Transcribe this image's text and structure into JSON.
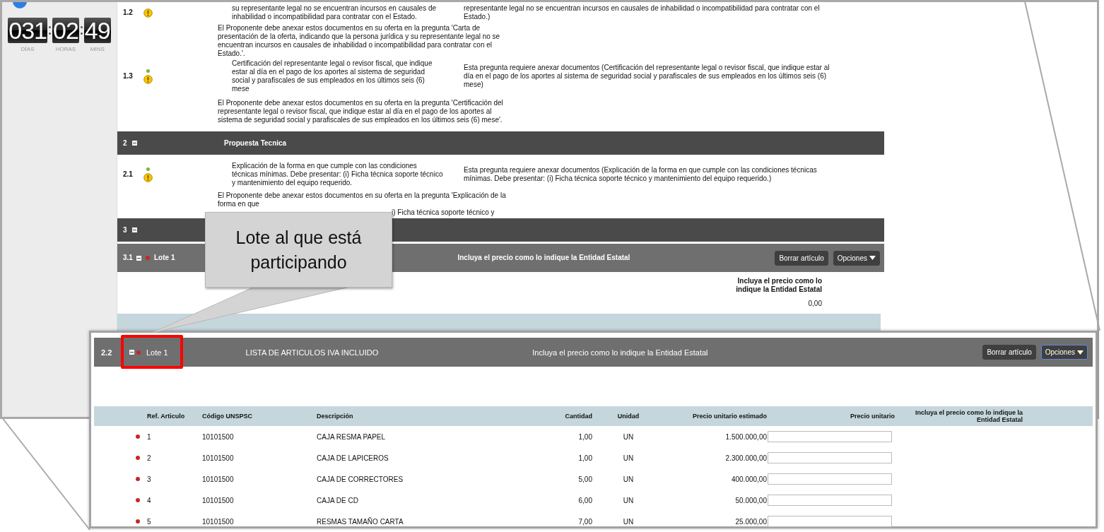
{
  "countdown": [
    {
      "value": "031",
      "label": "DÍAS"
    },
    {
      "value": "02",
      "label": "HORAS"
    },
    {
      "value": "49",
      "label": "MINS"
    }
  ],
  "items": [
    {
      "kind": "question",
      "number": "1.2",
      "warning": true,
      "text": "su representante legal no se encuentran incursos en causales de inhabilidad o incompatibilidad para contratar con el Estado.",
      "answer": "representante legal no se encuentran incursos en causales de inhabilidad o incompatibilidad para contratar con el Estado.)"
    },
    {
      "kind": "note",
      "text": "El Proponente debe anexar estos documentos en su oferta en la pregunta 'Carta de presentación de la oferta, indicando que la persona jurídica y su representante legal no se encuentran incursos en causales de inhabilidad o incompatibilidad para contratar con el Estado.'."
    },
    {
      "kind": "question",
      "number": "1.3",
      "color": "#7cb342",
      "warning": true,
      "text": "Certificación del representante legal o revisor fiscal, que indique estar al día en el pago de los aportes al sistema de seguridad social y parafiscales de sus empleados en los últimos seis (6) mese",
      "answer": "Esta pregunta requiere anexar documentos (Certificación del representante legal o revisor fiscal, que indique estar al día en el pago de los aportes al sistema de seguridad social y parafiscales de sus empleados en los últimos seis (6) mese)"
    },
    {
      "kind": "note",
      "text": "El Proponente debe anexar estos documentos en su oferta en la pregunta 'Certificación del representante legal o revisor fiscal, que indique estar al día en el pago de los aportes al sistema de seguridad social y parafiscales de sus empleados en los últimos seis (6) mese'."
    },
    {
      "kind": "section",
      "number": "2",
      "expanded": true,
      "title": "Propuesta Tecnica"
    },
    {
      "kind": "question",
      "number": "2.1",
      "color": "#7cb342",
      "warning": true,
      "text": "Explicación de la forma en que cumple con las condiciones técnicas mínimas. Debe presentar: (i) Ficha técnica soporte técnico y mantenimiento del equipo requerido.",
      "answer": "Esta pregunta requiere anexar documentos (Explicación de la forma en que cumple con las condiciones técnicas mínimas. Debe presentar: (i) Ficha técnica soporte técnico y mantenimiento del equipo requerido.)"
    },
    {
      "kind": "note",
      "text": "El Proponente debe anexar estos documentos en su oferta en la pregunta 'Explicación de la forma en que",
      "continuation": "i) Ficha técnica soporte técnico y"
    },
    {
      "kind": "section",
      "number": "3",
      "expanded": true
    },
    {
      "kind": "lot",
      "number": "3.1",
      "expanded": true,
      "color": "#c62828",
      "title": "Lote 1",
      "hint": "Incluya el precio como lo indique la Entidad Estatal",
      "buttons": [
        {
          "label": "Borrar artículo",
          "kind": "delete",
          "focused": false
        },
        {
          "label": "Opciones",
          "kind": "menu",
          "focused": false
        }
      ]
    },
    {
      "kind": "price",
      "label": "Incluya el precio como lo indique la Entidad Estatal",
      "value": "0,00"
    }
  ],
  "inset": {
    "number": "2.2",
    "expanded": true,
    "color": "#c62828",
    "lot": "Lote 1",
    "highlighted": true,
    "title": "LISTA DE ARTICULOS IVA INCLUIDO",
    "hint": "Incluya el precio como lo indique la Entidad Estatal",
    "buttons": [
      {
        "label": "Borrar artículo",
        "kind": "delete",
        "focused": false
      },
      {
        "label": "Opciones",
        "kind": "menu",
        "focused": true
      }
    ],
    "columns": [
      "Ref. Articulo",
      "Código UNSPSC",
      "Descripción",
      "Cantidad",
      "Unidad",
      "Precio unitario estimado",
      "Precio unitario",
      "Incluya el precio como lo indique la Entidad Estatal"
    ],
    "rows": [
      {
        "color": "#c62828",
        "ref": "1",
        "code": "10101500",
        "description": "CAJA RESMA PAPEL",
        "quantity": "1,00",
        "unit": "UN",
        "estimate": "1.500.000,00"
      },
      {
        "color": "#c62828",
        "ref": "2",
        "code": "10101500",
        "description": "CAJA DE LAPICEROS",
        "quantity": "1,00",
        "unit": "UN",
        "estimate": "2.300.000,00"
      },
      {
        "color": "#c62828",
        "ref": "3",
        "code": "10101500",
        "description": "CAJA DE CORRECTORES",
        "quantity": "5,00",
        "unit": "UN",
        "estimate": "400.000,00"
      },
      {
        "color": "#c62828",
        "ref": "4",
        "code": "10101500",
        "description": "CAJA DE CD",
        "quantity": "6,00",
        "unit": "UN",
        "estimate": "50.000,00"
      },
      {
        "color": "#c62828",
        "ref": "5",
        "code": "10101500",
        "description": "RESMAS TAMAÑO CARTA",
        "quantity": "7,00",
        "unit": "UN",
        "estimate": "25.000,00"
      }
    ]
  },
  "callout": {
    "text": "Lote al que está participando"
  }
}
